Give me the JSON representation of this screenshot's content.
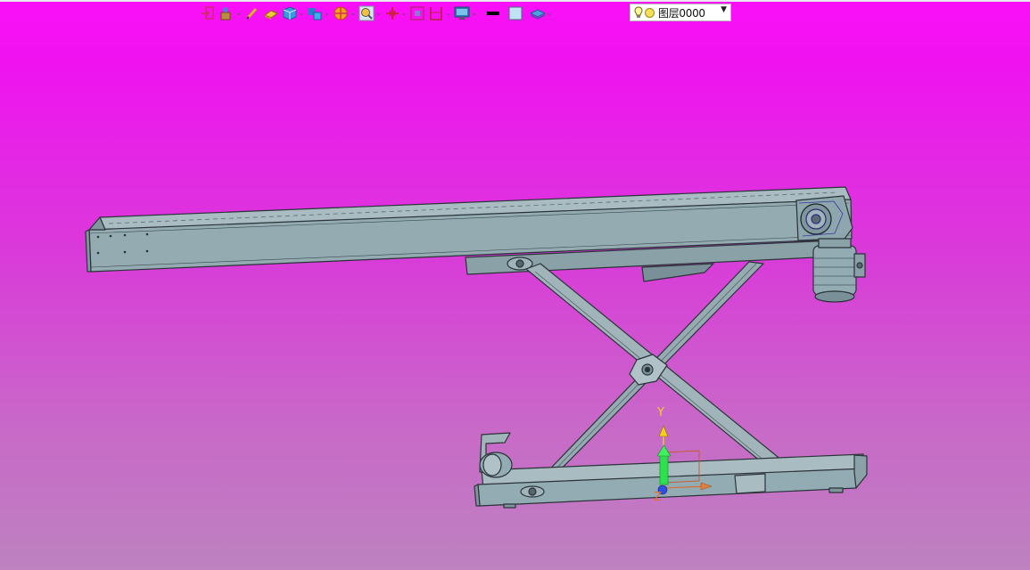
{
  "toolbar": {
    "items": [
      {
        "icon": "exit-icon",
        "dropdown": false
      },
      {
        "icon": "snap-icon",
        "dropdown": true
      },
      {
        "icon": "pen-icon",
        "dropdown": false
      },
      {
        "icon": "eraser-icon",
        "dropdown": false
      },
      {
        "icon": "cube-view-icon",
        "dropdown": true
      },
      {
        "icon": "component-icon",
        "dropdown": true
      },
      {
        "icon": "render-mode-icon",
        "dropdown": true
      },
      {
        "icon": "zoom-icon",
        "dropdown": true
      },
      {
        "icon": "pan-icon",
        "dropdown": true
      },
      {
        "icon": "fit-view-icon",
        "dropdown": false
      },
      {
        "icon": "section-icon",
        "dropdown": true
      },
      {
        "icon": "display-icon",
        "dropdown": true
      },
      {
        "icon": "line-color-icon",
        "dropdown": false
      },
      {
        "icon": "fill-color-icon",
        "dropdown": false
      },
      {
        "icon": "layer-stack-icon",
        "dropdown": true
      }
    ],
    "layer_selector": {
      "value": "图层0000",
      "icons": [
        "lightbulb-icon",
        "layer-status-icon"
      ]
    }
  },
  "viewport": {
    "background_top": "#fb10f8",
    "background_bottom": "#bd82bf",
    "model_color": "#93abb3",
    "edge_color": "#2a3338",
    "axis_triad": {
      "y_label": "Y",
      "z_label": "Z"
    }
  }
}
